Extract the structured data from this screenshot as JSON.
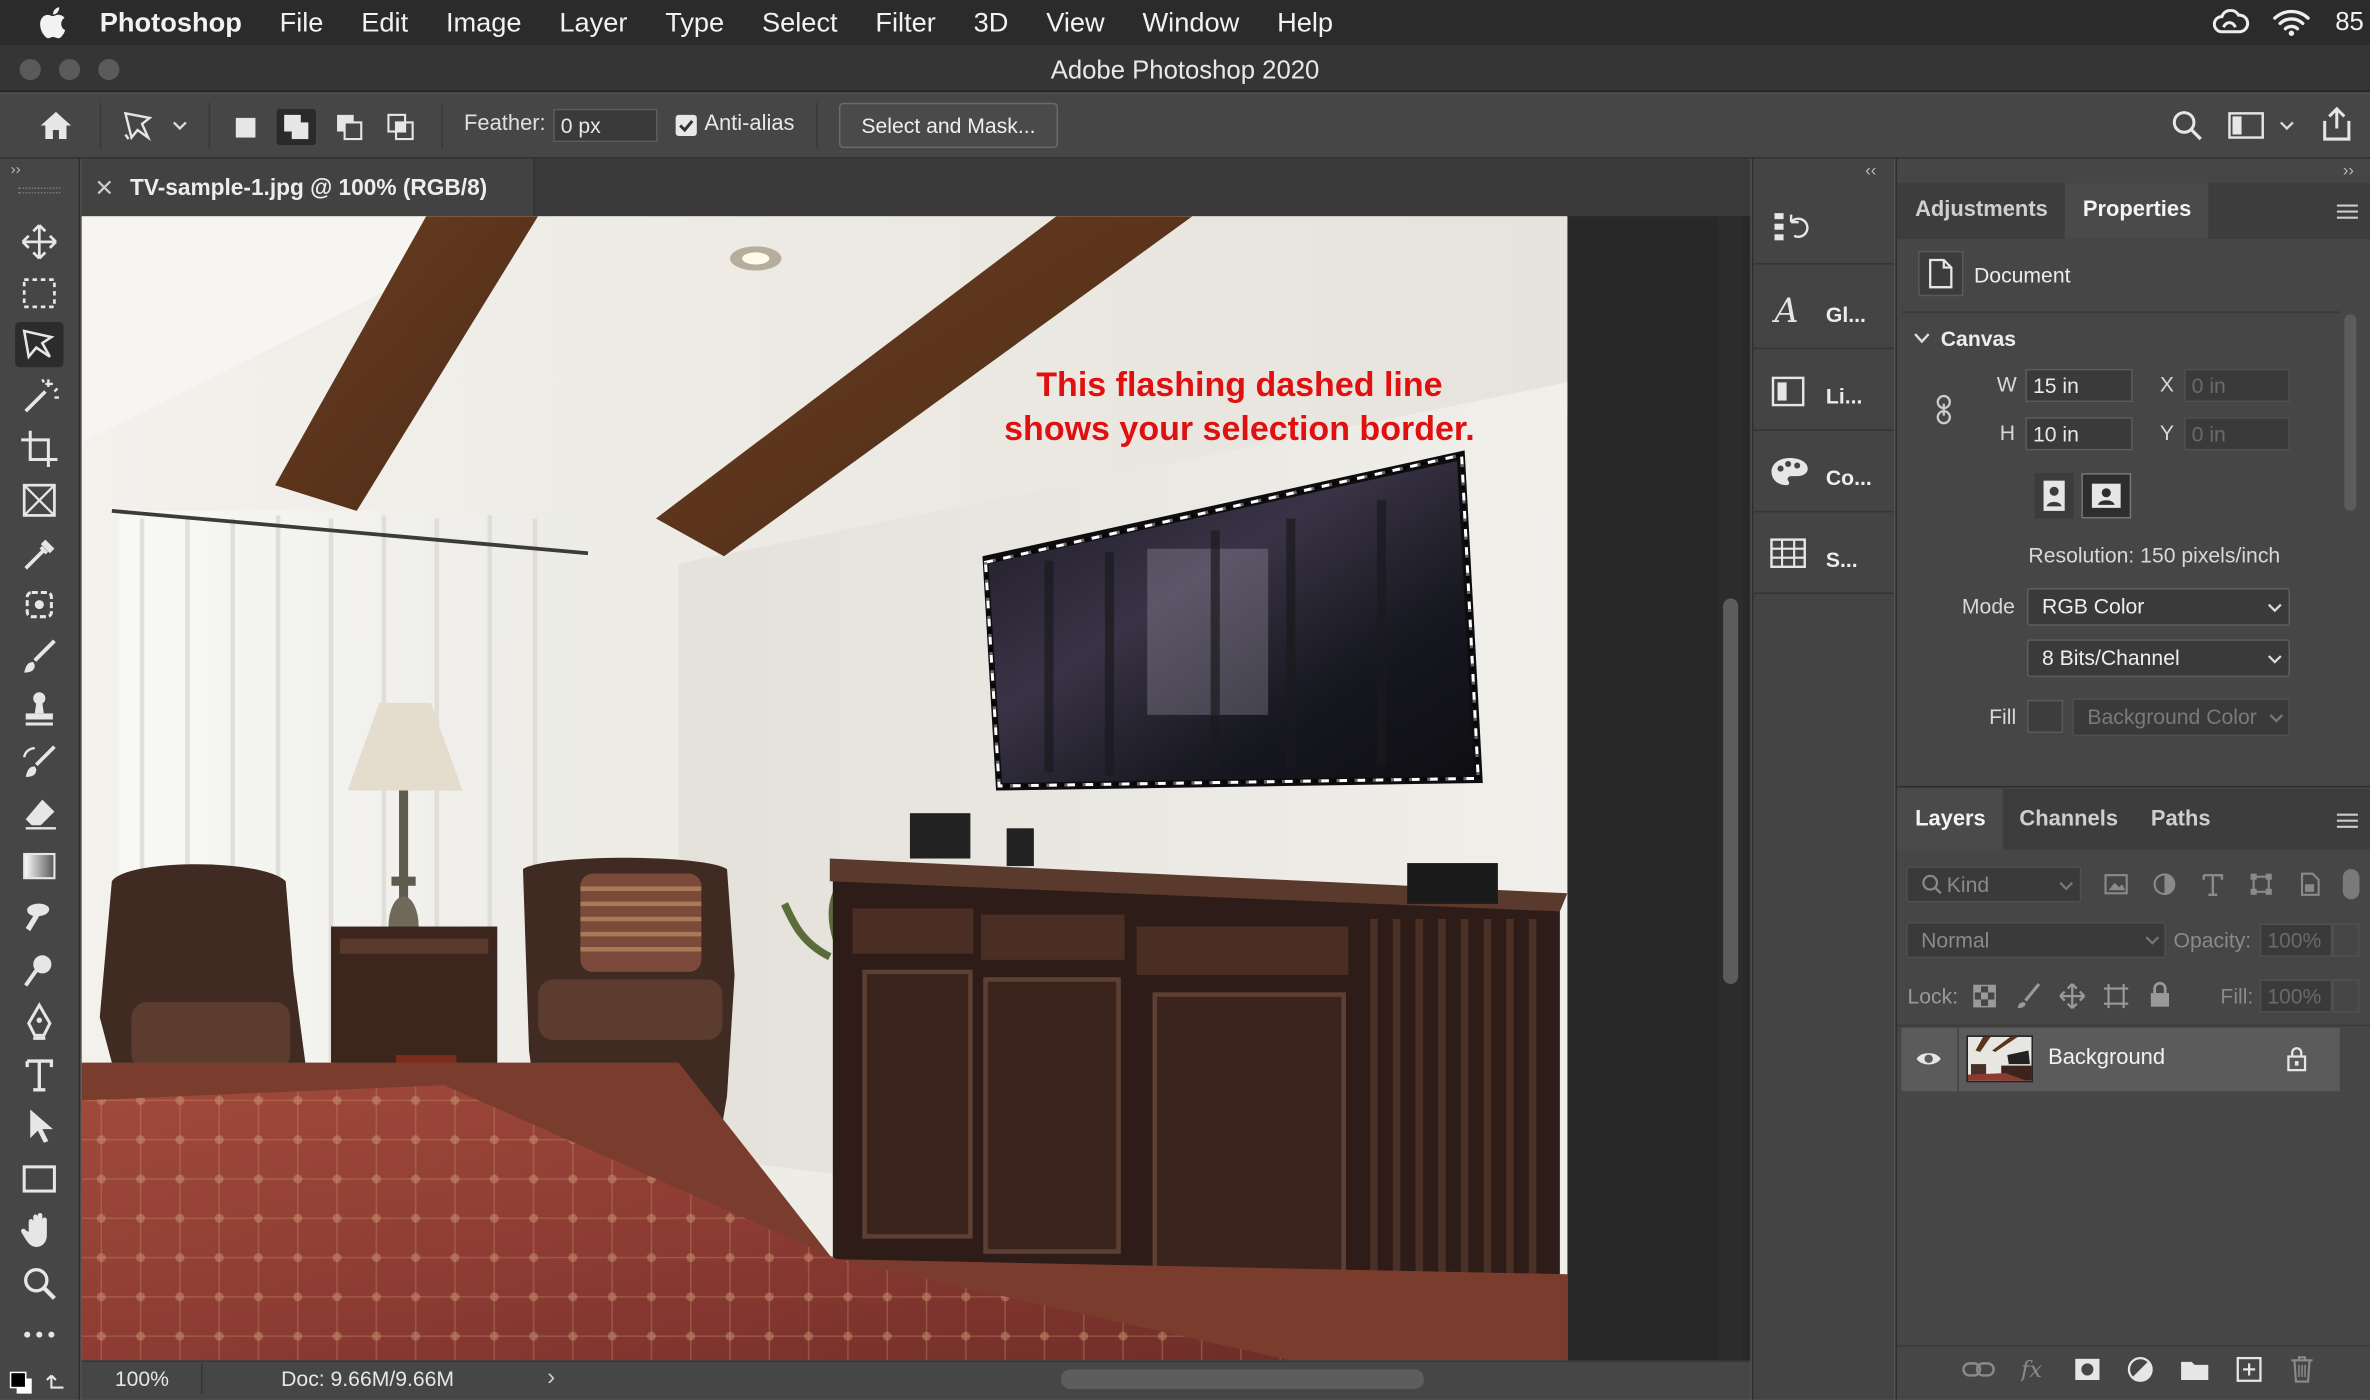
{
  "menubar": {
    "app_name": "Photoshop",
    "items": [
      "File",
      "Edit",
      "Image",
      "Layer",
      "Type",
      "Select",
      "Filter",
      "3D",
      "View",
      "Window",
      "Help"
    ],
    "battery": "85"
  },
  "window": {
    "title": "Adobe Photoshop 2020"
  },
  "options": {
    "feather_label": "Feather:",
    "feather_value": "0 px",
    "antialias_label": "Anti-alias",
    "antialias_checked": true,
    "select_mask_label": "Select and Mask..."
  },
  "document": {
    "tab_title": "TV-sample-1.jpg @ 100% (RGB/8)",
    "annotation_line1": "This flashing dashed line",
    "annotation_line2": "shows your selection border.",
    "annotation_color": "#e01010"
  },
  "status": {
    "zoom": "100%",
    "doc_size": "Doc: 9.66M/9.66M",
    "arrow": "›"
  },
  "dock": {
    "items": [
      "Gl...",
      "Li...",
      "Co...",
      "S..."
    ]
  },
  "properties": {
    "tabs": [
      "Adjustments",
      "Properties"
    ],
    "active_tab": "Properties",
    "document_label": "Document",
    "canvas_heading": "Canvas",
    "w_label": "W",
    "w_value": "15 in",
    "h_label": "H",
    "h_value": "10 in",
    "x_label": "X",
    "x_value": "0 in",
    "y_label": "Y",
    "y_value": "0 in",
    "resolution": "Resolution: 150 pixels/inch",
    "mode_label": "Mode",
    "mode_value": "RGB Color",
    "depth_value": "8 Bits/Channel",
    "fill_label": "Fill",
    "fill_value": "Background Color"
  },
  "layers": {
    "tabs": [
      "Layers",
      "Channels",
      "Paths"
    ],
    "active_tab": "Layers",
    "kind_label": "Kind",
    "blend_mode": "Normal",
    "opacity_label": "Opacity:",
    "opacity_value": "100%",
    "lock_label": "Lock:",
    "fill_label": "Fill:",
    "fill_value": "100%",
    "layer_list": [
      {
        "name": "Background",
        "visible": true,
        "locked": true
      }
    ]
  }
}
